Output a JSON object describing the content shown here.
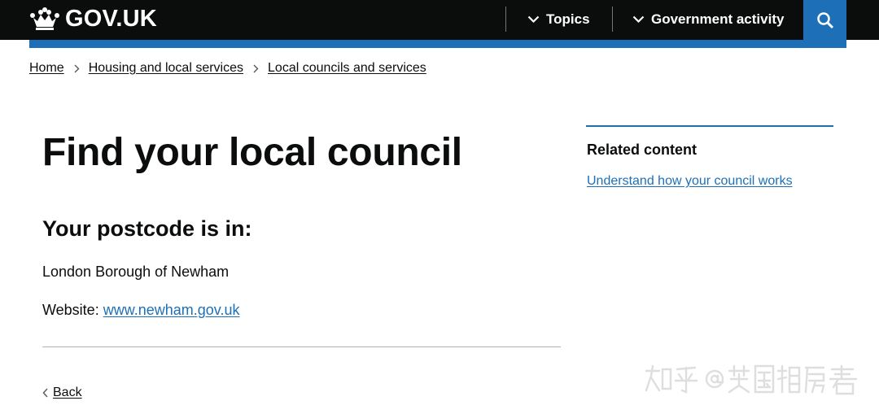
{
  "header": {
    "logo_text": "GOV.UK",
    "logo_icon": "crown-icon",
    "nav": [
      {
        "label": "Topics",
        "icon": "chevron-down-icon"
      },
      {
        "label": "Government activity",
        "icon": "chevron-down-icon"
      }
    ],
    "search_icon": "search-icon",
    "colors": {
      "header_bg": "#0b0c0c",
      "accent": "#1d70b8"
    }
  },
  "breadcrumb": [
    {
      "label": "Home"
    },
    {
      "label": "Housing and local services"
    },
    {
      "label": "Local councils and services"
    }
  ],
  "main": {
    "title": "Find your local council",
    "subhead": "Your postcode is in:",
    "council_name": "London Borough of Newham",
    "website_label": "Website:",
    "website_url": "www.newham.gov.uk",
    "back_label": "Back"
  },
  "sidebar": {
    "title": "Related content",
    "links": [
      {
        "label": "Understand how your council works"
      }
    ]
  },
  "watermark": {
    "label": "知乎 @英国租房君"
  },
  "colors": {
    "link": "#1d70b8",
    "text": "#0b0c0c",
    "divider": "#b1b4b6"
  }
}
